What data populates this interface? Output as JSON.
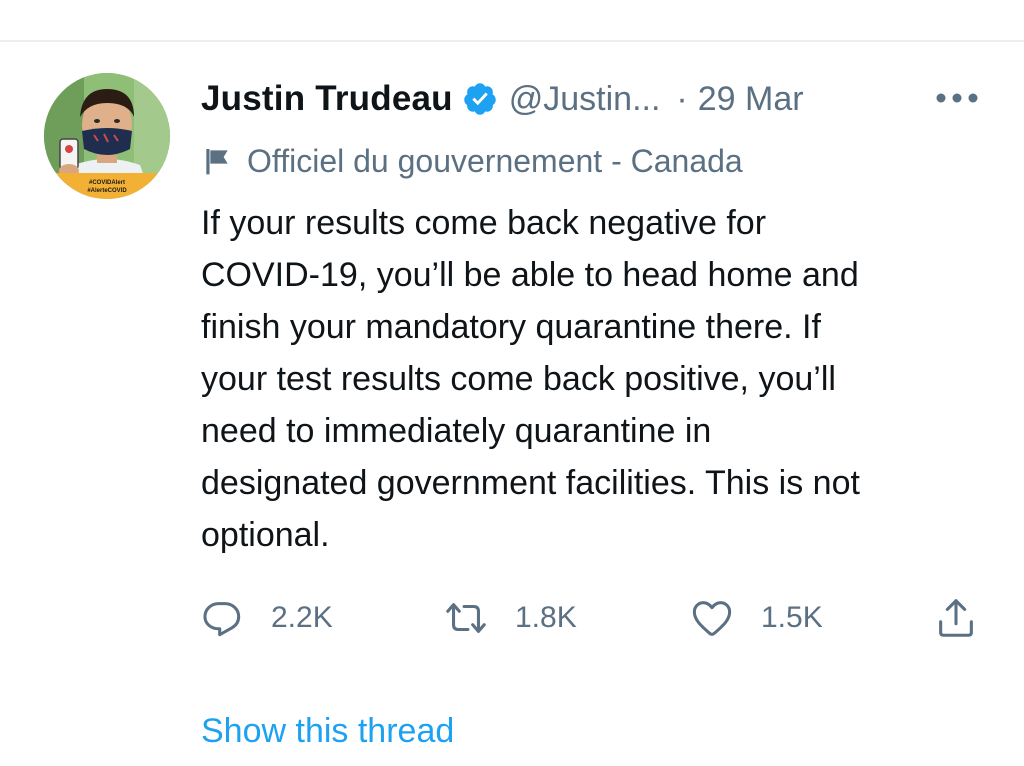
{
  "tweet": {
    "author_name": "Justin Trudeau",
    "handle": "@Justin...",
    "separator": "·",
    "date": "29 Mar",
    "label": "Officiel du gouvernement - Canada",
    "text": "If your results come back negative for\nCOVID-19, you’ll be able to head home and\nfinish your mandatory quarantine there. If\nyour test results come back positive, you’ll\nneed to immediately quarantine in\ndesignated government facilities. This is not\noptional.",
    "avatar_badge_lines": [
      "#COVIDAlert",
      "#AlerteCOVID"
    ]
  },
  "actions": {
    "reply_count": "2.2K",
    "retweet_count": "1.8K",
    "like_count": "1.5K"
  },
  "show_thread": "Show this thread",
  "colors": {
    "text_primary": "#0f1419",
    "text_secondary": "#5b7083",
    "link": "#1da1f2",
    "verified": "#1da1f2",
    "avatar_band": "#f2b134"
  },
  "icons": {
    "verified": "verified-badge-icon",
    "more": "more-dots-icon",
    "flag": "flag-icon",
    "reply": "reply-icon",
    "retweet": "retweet-icon",
    "like": "heart-icon",
    "share": "share-icon"
  }
}
